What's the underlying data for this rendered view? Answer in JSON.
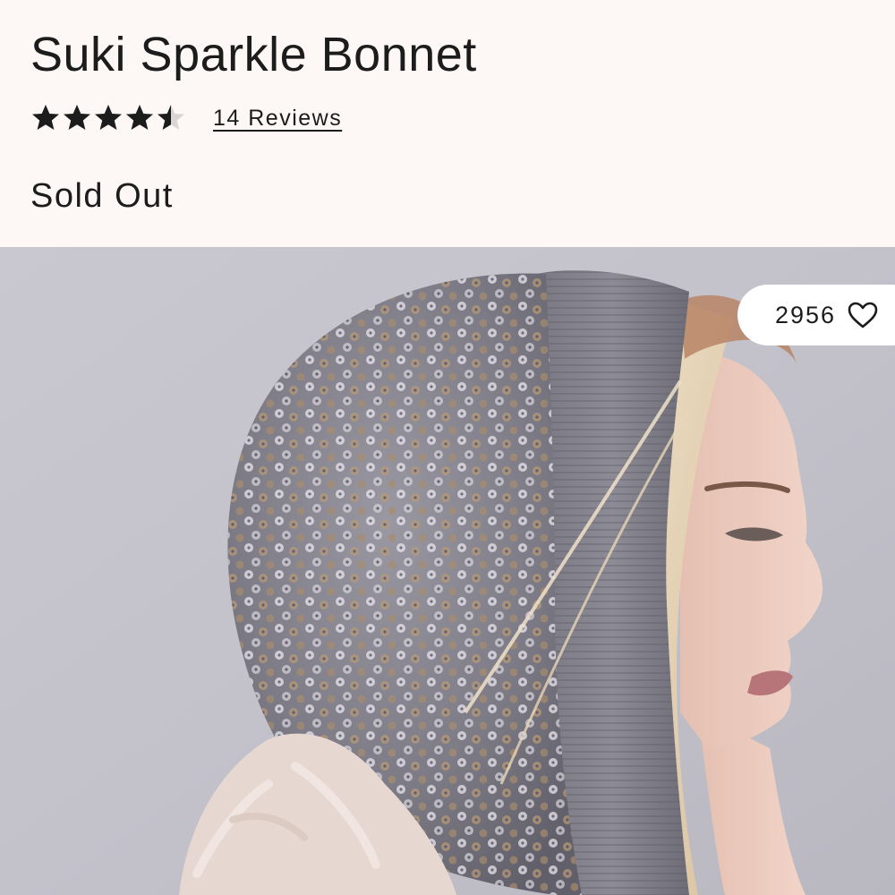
{
  "product": {
    "title": "Suki Sparkle Bonnet",
    "rating": 4.5,
    "rating_max": 5,
    "reviews_label": "14 Reviews",
    "stock_status": "Sold Out"
  },
  "image": {
    "alt": "Model wearing Suki Sparkle Bonnet",
    "like_count": "2956",
    "like_icon": "heart-outline-icon"
  },
  "colors": {
    "text": "#1c1c1c",
    "background": "#fdf8f6",
    "star_filled": "#1c1c1c",
    "star_empty": "#d9d6d4",
    "pill": "#ffffff"
  },
  "icons": {
    "star": "star-icon"
  }
}
